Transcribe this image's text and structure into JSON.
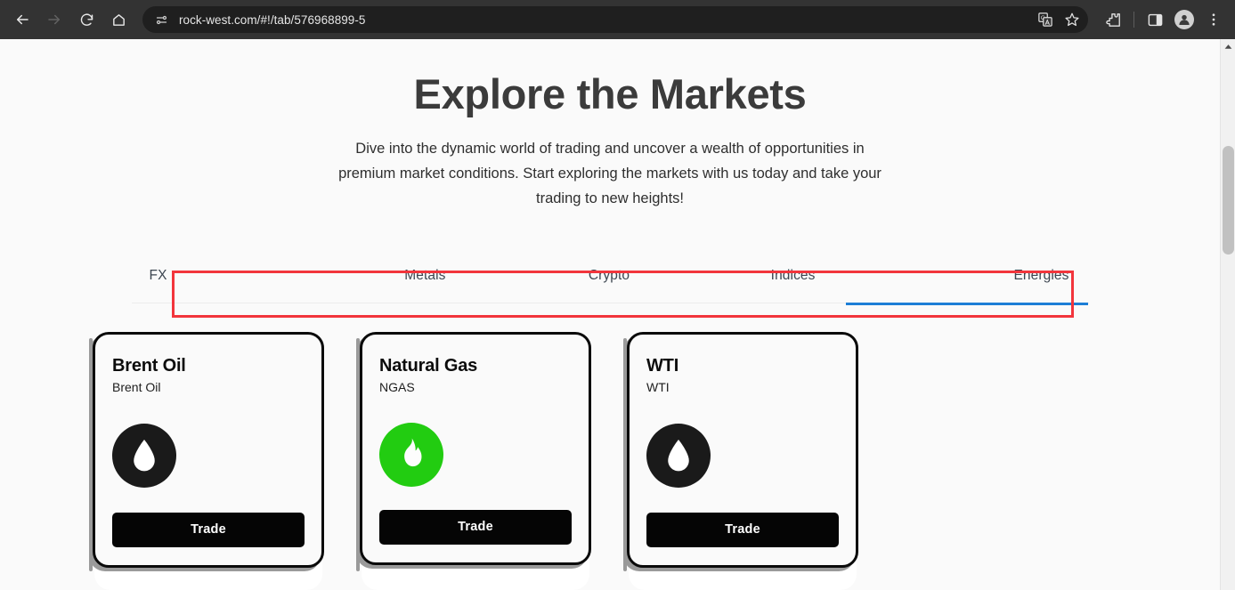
{
  "browser": {
    "back_label": "Back",
    "forward_label": "Forward",
    "reload_label": "Reload",
    "home_label": "Home",
    "url": "rock-west.com/#!/tab/576968899-5",
    "site_info_icon": "tune-icon",
    "translate_icon": "translate-icon",
    "bookmark_icon": "star-icon",
    "extensions_icon": "puzzle-piece-icon",
    "side_panel_icon": "side-panel-icon",
    "profile_icon": "avatar-icon",
    "menu_icon": "three-dot-menu-icon"
  },
  "hero": {
    "title": "Explore the Markets",
    "subtitle": "Dive into the dynamic world of trading and uncover a wealth of opportunities in premium market conditions. Start exploring the markets with us today and take your trading to new heights!"
  },
  "tabs": {
    "items": [
      {
        "label": "FX",
        "active": false
      },
      {
        "label": "Metals",
        "active": false
      },
      {
        "label": "Crypto",
        "active": false
      },
      {
        "label": "Indices",
        "active": false
      },
      {
        "label": "Energies",
        "active": true
      }
    ],
    "active_index": 4,
    "indicator_color": "#1c7ed6",
    "annotation_color": "#f2353c"
  },
  "cards": [
    {
      "title": "Brent Oil",
      "symbol": "Brent Oil",
      "icon": "oil-droplet-icon",
      "icon_bg": "#1a1a1a",
      "icon_fg": "#ffffff",
      "button_label": "Trade"
    },
    {
      "title": "Natural Gas",
      "symbol": "NGAS",
      "icon": "flame-icon",
      "icon_bg": "#22cc11",
      "icon_fg": "#fdfdfd",
      "button_label": "Trade"
    },
    {
      "title": "WTI",
      "symbol": "WTI",
      "icon": "oil-droplet-icon",
      "icon_bg": "#1a1a1a",
      "icon_fg": "#ffffff",
      "button_label": "Trade"
    }
  ],
  "scrollbar": {
    "up_arrow_icon": "caret-up-icon"
  }
}
